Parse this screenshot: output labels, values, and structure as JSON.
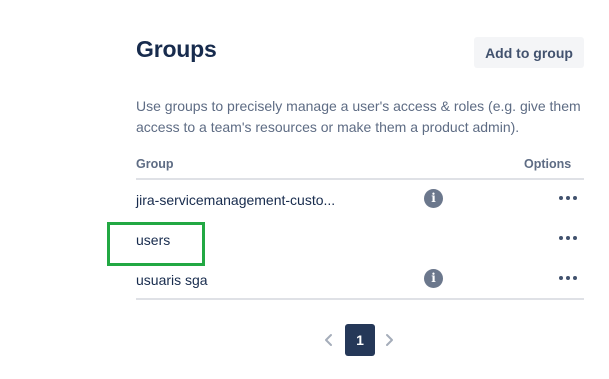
{
  "header": {
    "title": "Groups",
    "add_button_label": "Add to group"
  },
  "description": "Use groups to precisely manage a user's access & roles (e.g. give them access to a team's resources or make them a product admin).",
  "table": {
    "columns": [
      "Group",
      "Options"
    ],
    "rows": [
      {
        "name": "jira-servicemanagement-custo...",
        "has_info": true
      },
      {
        "name": "users",
        "has_info": false
      },
      {
        "name": "usuaris sga",
        "has_info": true
      }
    ]
  },
  "highlight_color": "#22a843",
  "pagination": {
    "current_page": "1",
    "prev_icon": "chevron-left-icon",
    "next_icon": "chevron-right-icon"
  },
  "icons": {
    "info": "info-icon",
    "more": "more-horizontal-icon"
  }
}
